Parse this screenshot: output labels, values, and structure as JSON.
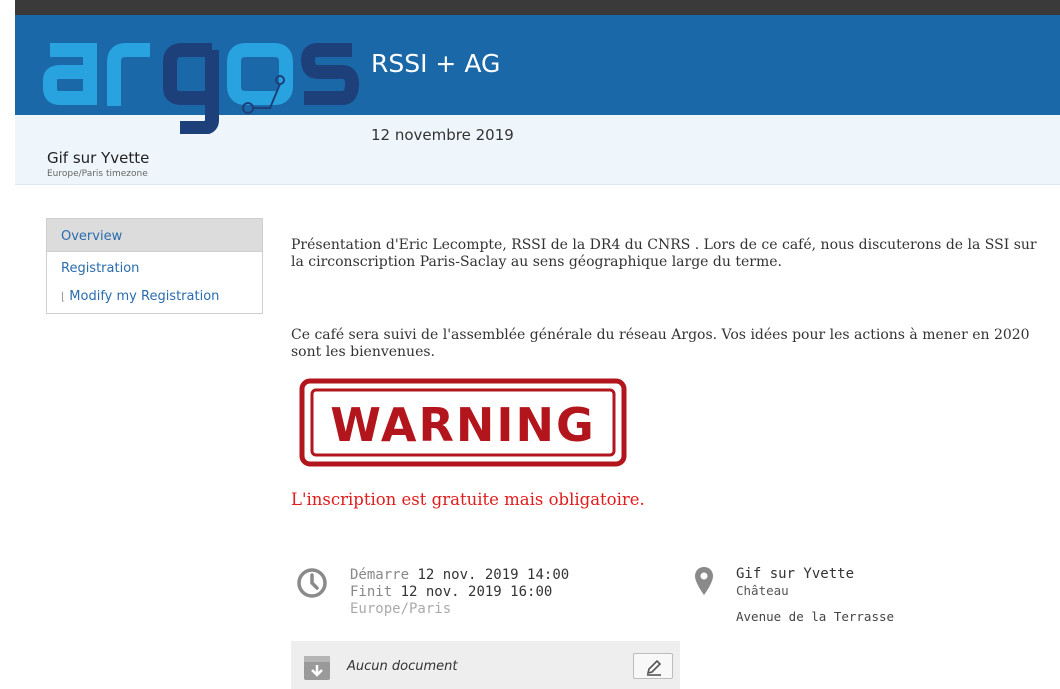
{
  "header": {
    "logo_text": "argos",
    "event_title": "RSSI + AG",
    "event_date": "12 novembre 2019",
    "city": "Gif sur Yvette",
    "timezone_note": "Europe/Paris timezone"
  },
  "menu": {
    "items": [
      {
        "label": "Overview"
      },
      {
        "label": "Registration"
      },
      {
        "label": "Modify my Registration"
      }
    ]
  },
  "content": {
    "paragraph1": "Présentation d'Eric Lecompte, RSSI de la DR4 du CNRS . Lors de ce café, nous discuterons de la SSI sur la circonscription Paris-Saclay au sens géographique large du terme.",
    "paragraph2": "Ce café sera suivi de l'assemblée générale du réseau Argos. Vos idées pour les actions à mener en 2020 sont les bienvenues.",
    "warning_text": "WARNING",
    "notice": "L'inscription est gratuite mais obligatoire."
  },
  "time": {
    "start_label": "Démarre",
    "start_value": "12 nov. 2019 14:00",
    "end_label": "Finit",
    "end_value": "12 nov. 2019 16:00",
    "tz": "Europe/Paris"
  },
  "location": {
    "name": "Gif sur Yvette",
    "room": "Château",
    "address": "Avenue de la Terrasse"
  },
  "documents": {
    "empty_text": "Aucun document"
  },
  "colors": {
    "header_blue": "#1b68a8",
    "logo_light": "#29a3e0",
    "logo_dark": "#1d3f7a",
    "notice_red": "#e01c1c",
    "warning_red": "#b3151c"
  }
}
